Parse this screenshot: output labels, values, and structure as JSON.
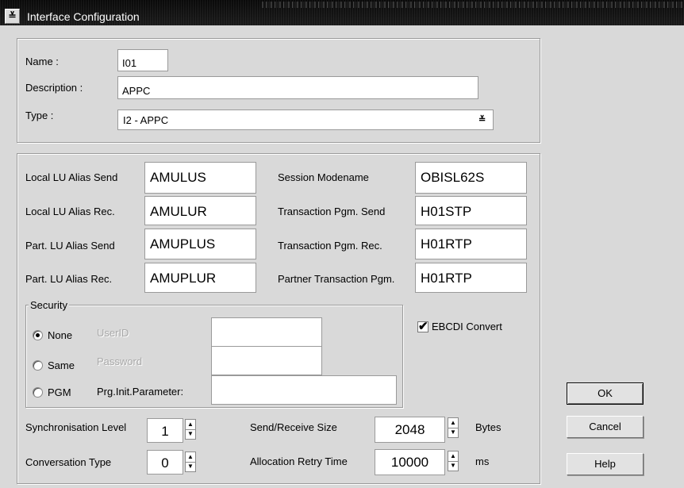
{
  "window": {
    "title": "Interface Configuration",
    "sysmenu_glyph": "≚"
  },
  "header": {
    "name_label": "Name :",
    "name_value": "I01",
    "description_label": "Description :",
    "description_value": "APPC",
    "type_label": "Type :",
    "type_value": "I2 - APPC",
    "type_dropdown_glyph": "≚"
  },
  "params": {
    "local_lu_send_label": "Local LU Alias Send",
    "local_lu_send_value": "AMULUS",
    "local_lu_rec_label": "Local LU Alias Rec.",
    "local_lu_rec_value": "AMULUR",
    "part_lu_send_label": "Part. LU Alias Send",
    "part_lu_send_value": "AMUPLUS",
    "part_lu_rec_label": "Part. LU Alias Rec.",
    "part_lu_rec_value": "AMUPLUR",
    "session_modename_label": "Session Modename",
    "session_modename_value": "OBISL62S",
    "tp_send_label": "Transaction Pgm. Send",
    "tp_send_value": "H01STP",
    "tp_rec_label": "Transaction Pgm. Rec.",
    "tp_rec_value": "H01RTP",
    "partner_tp_label": "Partner Transaction Pgm.",
    "partner_tp_value": "H01RTP"
  },
  "security": {
    "legend": "Security",
    "options": [
      {
        "label": "None",
        "selected": true
      },
      {
        "label": "Same",
        "selected": false
      },
      {
        "label": "PGM",
        "selected": false
      }
    ],
    "userid_label": "UserID",
    "userid_value": "",
    "password_label": "Password",
    "password_value": "",
    "prg_init_label": "Prg.Init.Parameter:",
    "prg_init_value": ""
  },
  "ebcdi": {
    "label": "EBCDI Convert",
    "checked": true,
    "check_glyph": "✔"
  },
  "sync": {
    "sync_level_label": "Synchronisation Level",
    "sync_level_value": "1",
    "conv_type_label": "Conversation Type",
    "conv_type_value": "0",
    "send_recv_label": "Send/Receive Size",
    "send_recv_value": "2048",
    "send_recv_unit": "Bytes",
    "alloc_retry_label": "Allocation Retry Time",
    "alloc_retry_value": "10000",
    "alloc_retry_unit": "ms"
  },
  "spin_glyphs": {
    "up": "▲",
    "down": "▼"
  },
  "buttons": {
    "ok": "OK",
    "cancel": "Cancel",
    "help": "Help"
  }
}
